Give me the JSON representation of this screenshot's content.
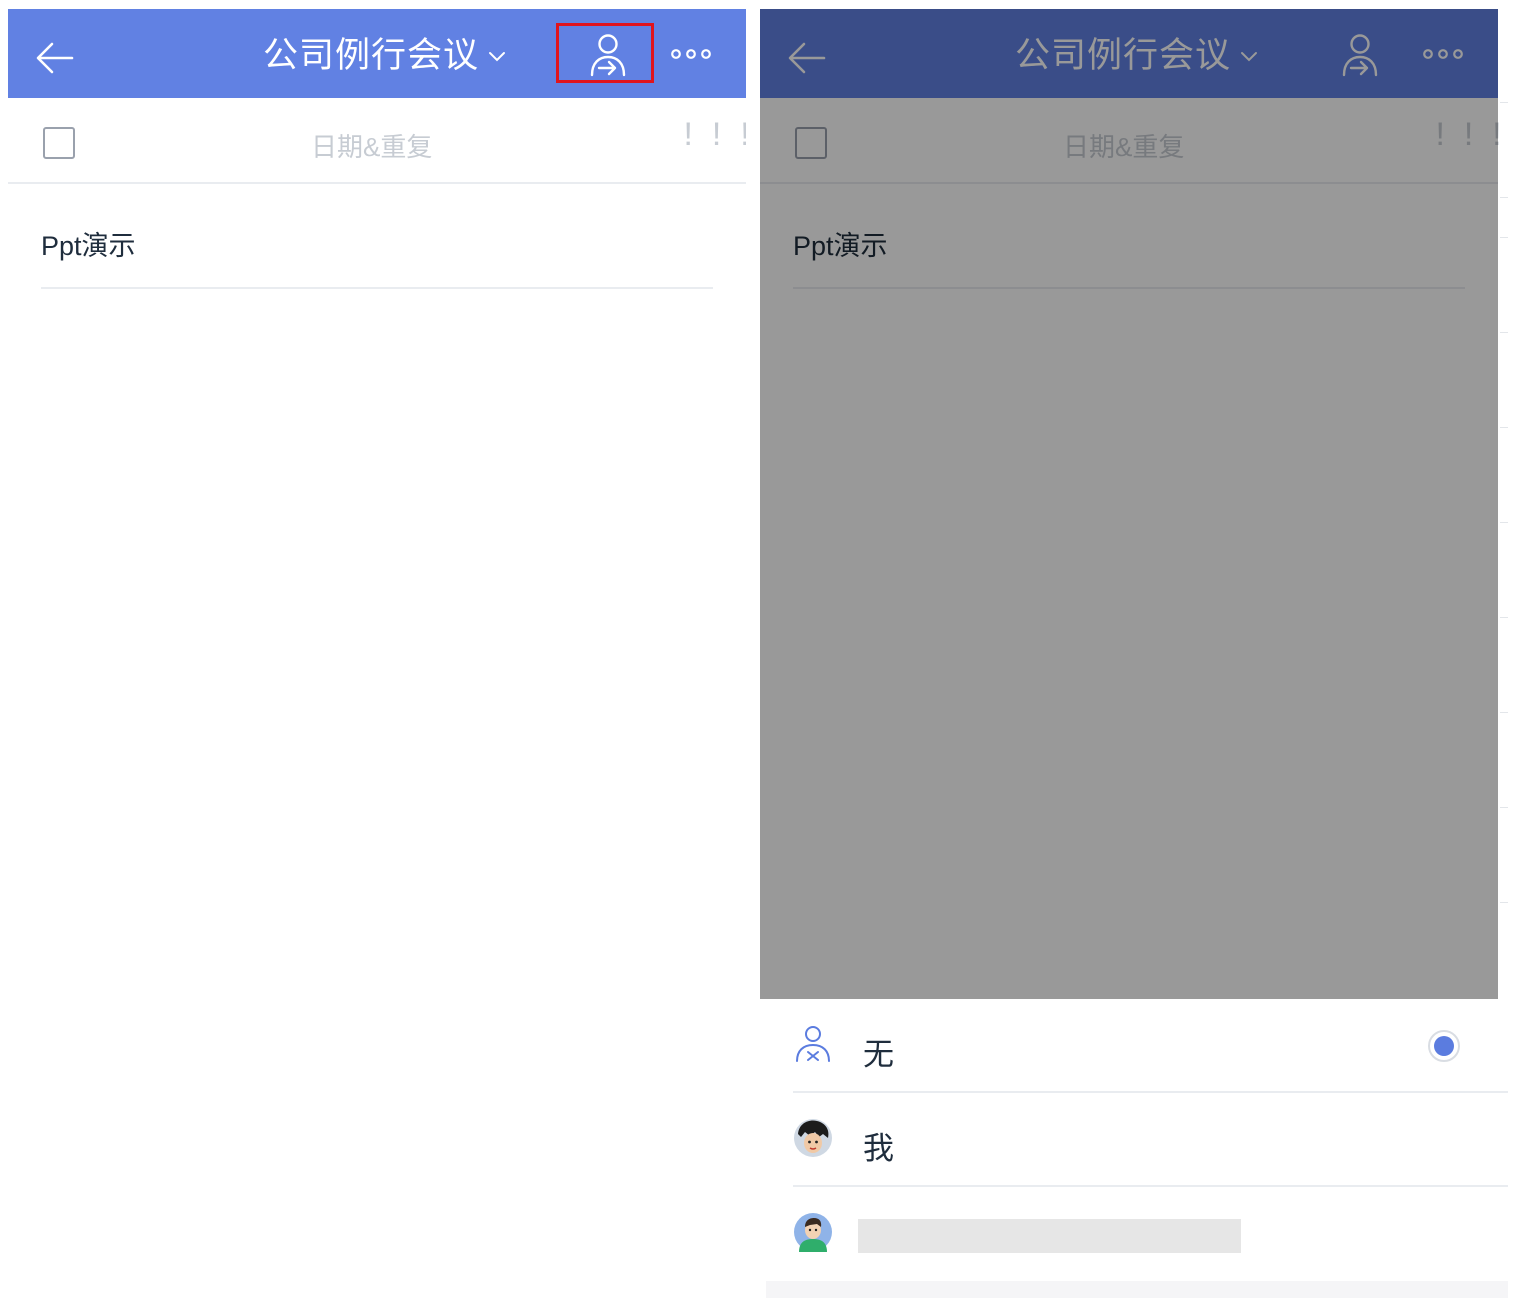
{
  "left": {
    "header": {
      "title": "公司例行会议",
      "bg_color": "#6181e3",
      "icons": [
        "back-arrow-icon",
        "chevron-down-icon",
        "assign-person-icon",
        "more-icon"
      ],
      "highlight_color": "#e0141e"
    },
    "toolbar": {
      "date_label": "日期&重复",
      "priority_label": "!!!"
    },
    "note": "Ppt演示"
  },
  "right": {
    "header": {
      "title": "公司例行会议",
      "bg_color": "#3a4a86"
    },
    "toolbar": {
      "date_label": "日期&重复",
      "priority_label": "!!!"
    },
    "note": "Ppt演示",
    "sheet": {
      "items": [
        {
          "label": "无",
          "icon": "no-assignee-icon",
          "selected": true
        },
        {
          "label": "我",
          "icon": "avatar-me",
          "selected": false
        },
        {
          "label": "",
          "icon": "avatar-other",
          "selected": false
        }
      ],
      "accent_color": "#5b7cdf"
    }
  }
}
